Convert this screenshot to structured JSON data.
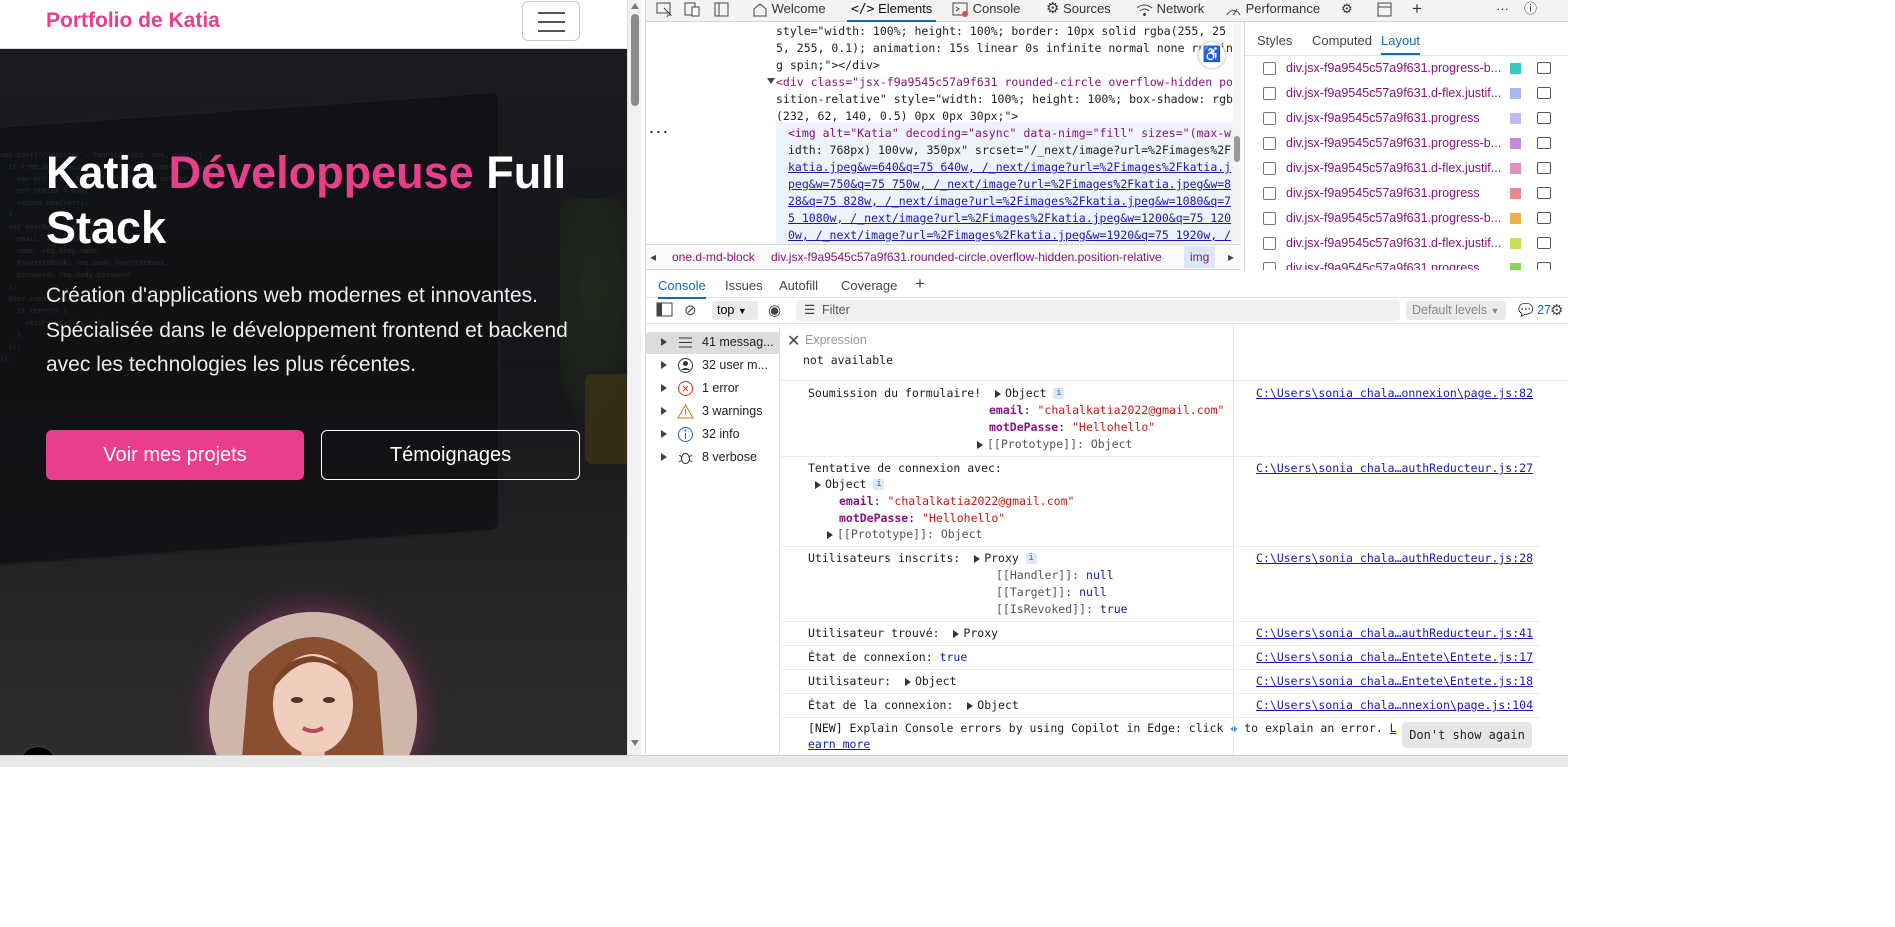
{
  "site": {
    "brand": "Portfolio de Katia",
    "hero": {
      "title_part1": "Katia",
      "title_accent": "Développeuse",
      "title_part2": "Full Stack",
      "subtitle": "Création d'applications web modernes et innovantes. Spécialisée dans le développement frontend et backend avec les technologies les plus récentes.",
      "cta_primary": "Voir mes projets",
      "cta_secondary": "Témoignages"
    },
    "nextjs_badge": "N",
    "colors": {
      "accent": "#e83e8c",
      "hero_bg": "#1d1e22"
    }
  },
  "devtools": {
    "tabs": [
      "Welcome",
      "Elements",
      "Console",
      "Sources",
      "Network",
      "Performance"
    ],
    "active_tab": "Elements",
    "elements": {
      "lines": [
        "style=\"width: 100%; height: 100%; border: 10px solid rgba(255, 25",
        "5, 255, 0.1); animation: 15s linear 0s infinite normal none runnin",
        "g spin;\"></div>",
        "<div class=\"jsx-f9a9545c57a9f631 rounded-circle overflow-hidden po",
        "sition-relative\" style=\"width: 100%; height: 100%; box-shadow: rgba",
        "(232, 62, 140, 0.5) 0px 0px 30px;\">",
        "<img alt=\"Katia\" decoding=\"async\" data-nimg=\"fill\" sizes=\"(max-w",
        "idth: 768px) 100vw, 350px\" srcset=\"/_next/image?url=%2Fimages%2F",
        "katia.jpeg&w=640&q=75 640w, /_next/image?url=%2Fimages%2Fkatia.j",
        "peg&w=750&q=75 750w, /_next/image?url=%2Fimages%2Fkatia.jpeg&w=8",
        "28&q=75 828w, /_next/image?url=%2Fimages%2Fkatia.jpeg&w=1080&q=7",
        "5 1080w, /_next/image?url=%2Fimages%2Fkatia.jpeg&w=1200&q=75 120",
        "0w, /_next/image?url=%2Fimages%2Fkatia.jpeg&w=1920&q=75 1920w, /"
      ],
      "ellipsis": "..."
    },
    "breadcrumb": {
      "items": [
        "one.d-md-block",
        "div.jsx-f9a9545c57a9f631.rounded-circle.overflow-hidden.position-relative"
      ],
      "current": "img"
    },
    "styles_tabs": [
      "Styles",
      "Computed",
      "Layout"
    ],
    "styles_active": "Layout",
    "layout_rows": [
      {
        "label": "div.jsx-f9a9545c57a9f631.progress-b...",
        "color": "#3bc6c6"
      },
      {
        "label": "div.jsx-f9a9545c57a9f631.d-flex.justif...",
        "color": "#a8b8f0"
      },
      {
        "label": "div.jsx-f9a9545c57a9f631.progress",
        "color": "#c7b7f0"
      },
      {
        "label": "div.jsx-f9a9545c57a9f631.progress-b...",
        "color": "#c78ad8"
      },
      {
        "label": "div.jsx-f9a9545c57a9f631.d-flex.justif...",
        "color": "#e28ec0"
      },
      {
        "label": "div.jsx-f9a9545c57a9f631.progress",
        "color": "#e88a8a"
      },
      {
        "label": "div.jsx-f9a9545c57a9f631.progress-b...",
        "color": "#e8b04a"
      },
      {
        "label": "div.jsx-f9a9545c57a9f631.d-flex.justif...",
        "color": "#c9dd52"
      },
      {
        "label": "div.jsx-f9a9545c57a9f631.progress",
        "color": "#8ad25a"
      }
    ],
    "console_tabs": [
      "Console",
      "Issues",
      "Autofill",
      "Coverage"
    ],
    "console_active": "Console",
    "context": "top",
    "filter_placeholder": "Filter",
    "levels": "Default levels",
    "issues_count": "27",
    "sidebar": [
      {
        "label": "41 messag...",
        "icon": "list-icon"
      },
      {
        "label": "32 user m...",
        "icon": "user-icon"
      },
      {
        "label": "1 error",
        "icon": "error-icon"
      },
      {
        "label": "3 warnings",
        "icon": "warning-icon"
      },
      {
        "label": "32 info",
        "icon": "info-icon"
      },
      {
        "label": "8 verbose",
        "icon": "bug-icon"
      }
    ],
    "expression": {
      "placeholder": "Expression",
      "value": "not available"
    },
    "messages": {
      "m1": {
        "text": "Soumission du formulaire!",
        "obj": "Object",
        "src": "C:\\Users\\sonia chala…onnexion\\page.js:82",
        "k1": "email",
        "v1": "\"chalalkatia2022@gmail.com\"",
        "k2": "motDePasse",
        "v2": "\"Hellohello\"",
        "proto": "[[Prototype]]",
        "proto_v": "Object"
      },
      "m2": {
        "text": "Tentative de connexion avec:",
        "obj": "Object",
        "src": "C:\\Users\\sonia chala…authReducteur.js:27",
        "k1": "email",
        "v1": "\"chalalkatia2022@gmail.com\"",
        "k2": "motDePasse",
        "v2": "\"Hellohello\"",
        "proto": "[[Prototype]]",
        "proto_v": "Object"
      },
      "m3": {
        "text": "Utilisateurs inscrits:",
        "obj": "Proxy",
        "src": "C:\\Users\\sonia chala…authReducteur.js:28",
        "h": "[[Handler]]",
        "hv": "null",
        "t": "[[Target]]",
        "tv": "null",
        "r": "[[IsRevoked]]",
        "rv": "true"
      },
      "m4": {
        "text": "Utilisateur trouvé:",
        "obj": "Proxy",
        "src": "C:\\Users\\sonia chala…authReducteur.js:41"
      },
      "m5": {
        "text": "État de connexion:",
        "val": "true",
        "src": "C:\\Users\\sonia chala…Entete\\Entete.js:17"
      },
      "m6": {
        "text": "Utilisateur:",
        "obj": "Object",
        "src": "C:\\Users\\sonia chala…Entete\\Entete.js:18"
      },
      "m7": {
        "text": "État de la connexion:",
        "obj": "Object",
        "src": "C:\\Users\\sonia chala…nnexion\\page.js:104"
      },
      "m8": {
        "line1": "[NEW] Explain Console errors by using Copilot in Edge: click",
        "line1b": "to explain an error.",
        "link": "L",
        "line2": "earn more"
      }
    },
    "dont_show": "Don't show again"
  }
}
